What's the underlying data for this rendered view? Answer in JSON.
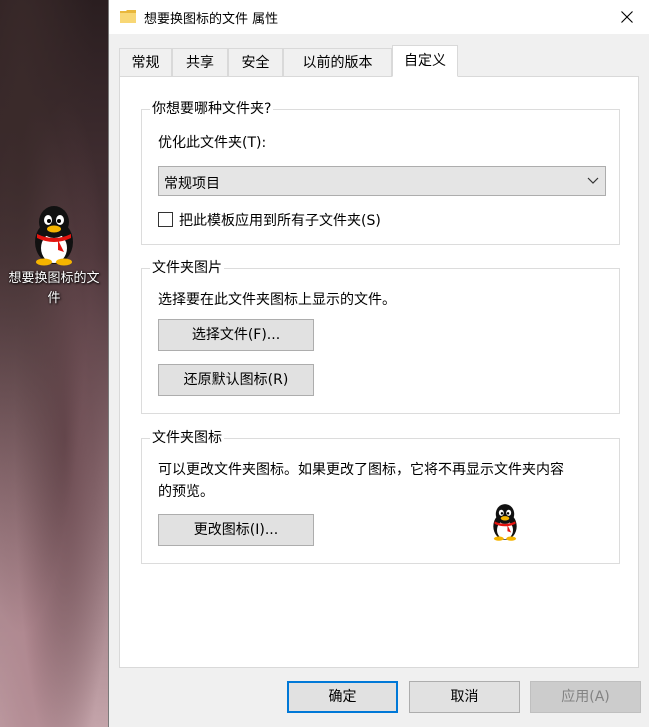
{
  "desktop": {
    "icon_label": "想要换图标的文件"
  },
  "window": {
    "title": "想要换图标的文件 属性",
    "close_glyph": "✕"
  },
  "tabs": [
    {
      "label": "常规"
    },
    {
      "label": "共享"
    },
    {
      "label": "安全"
    },
    {
      "label": "以前的版本"
    },
    {
      "label": "自定义",
      "active": true
    }
  ],
  "customize": {
    "folder_type": {
      "legend": "你想要哪种文件夹?",
      "optimize_label": "优化此文件夹(T):",
      "selected_option": "常规项目",
      "apply_subfolders_label": "把此模板应用到所有子文件夹(S)",
      "apply_subfolders_checked": false
    },
    "folder_picture": {
      "legend": "文件夹图片",
      "description": "选择要在此文件夹图标上显示的文件。",
      "choose_file_button": "选择文件(F)...",
      "restore_default_button": "还原默认图标(R)"
    },
    "folder_icon": {
      "legend": "文件夹图标",
      "description_line1": "可以更改文件夹图标。如果更改了图标，它将不再显示文件夹内容",
      "description_line2": "的预览。",
      "change_icon_button": "更改图标(I)..."
    }
  },
  "buttons": {
    "ok": "确定",
    "cancel": "取消",
    "apply": "应用(A)"
  },
  "colors": {
    "accent": "#0078d7",
    "window_bg": "#f0f0f0",
    "panel_bg": "#ffffff"
  },
  "icons": [
    "folder-icon",
    "close-icon",
    "chevron-down-icon",
    "qq-penguin-icon"
  ]
}
